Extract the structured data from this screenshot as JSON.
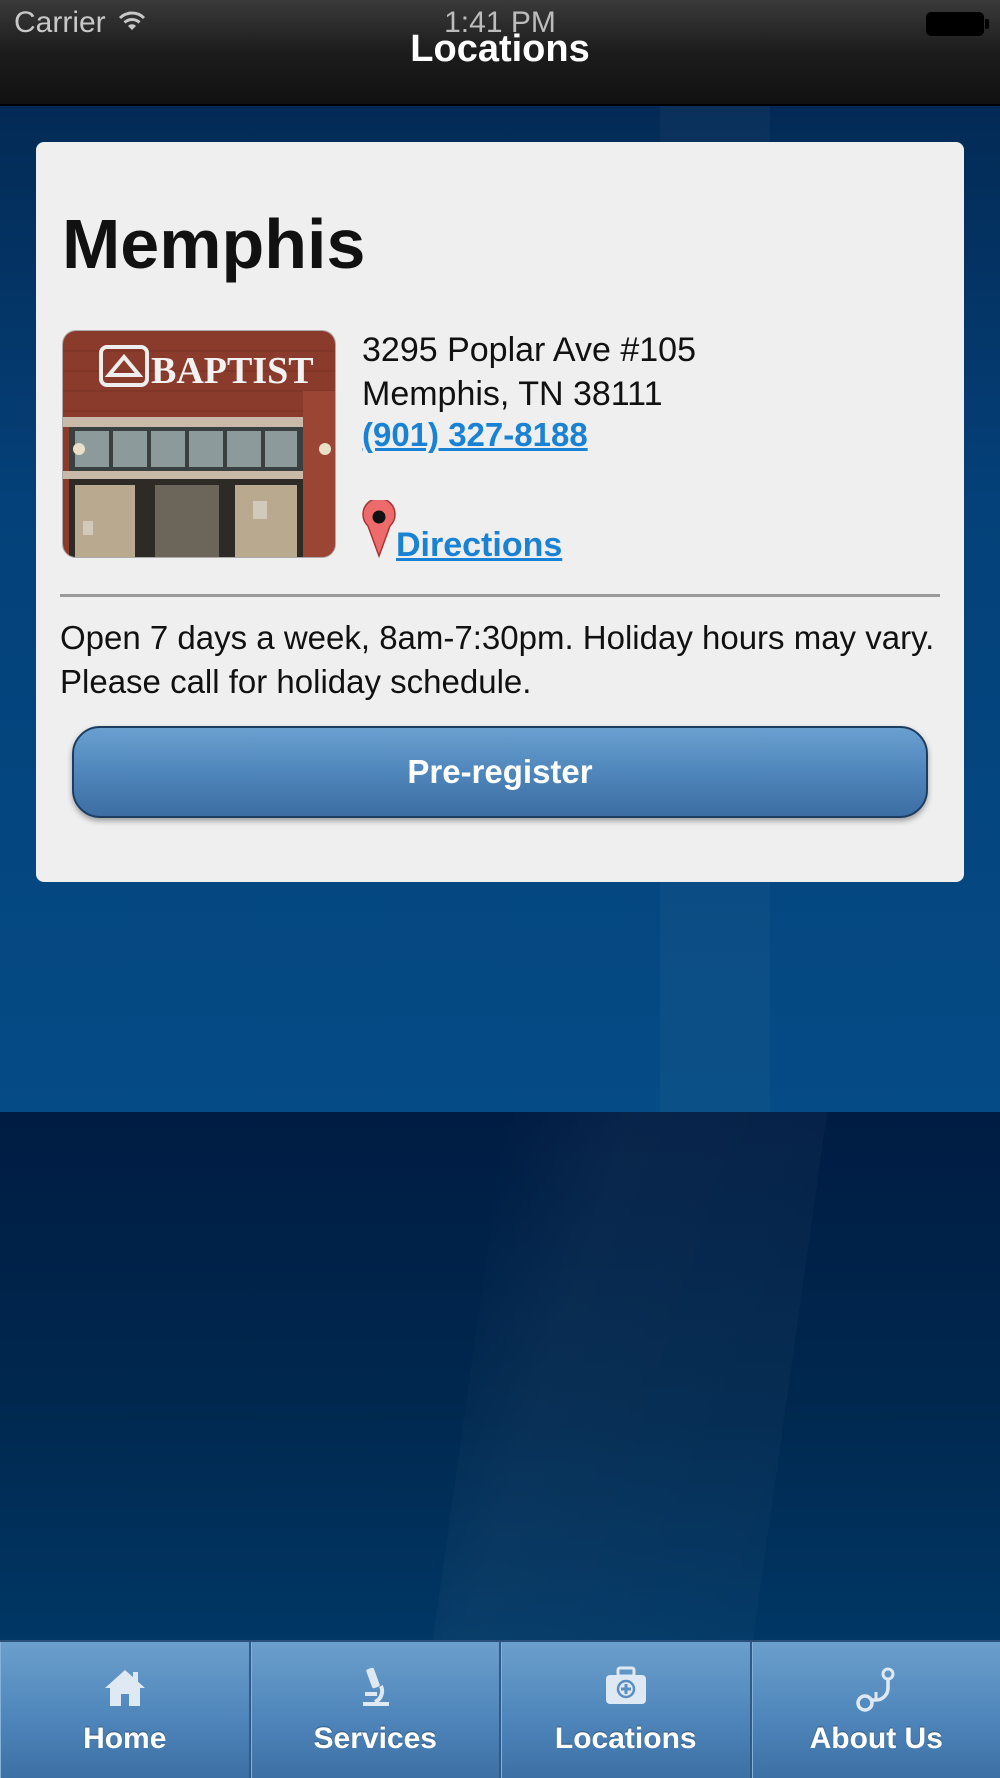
{
  "status_bar": {
    "carrier": "Carrier",
    "time": "1:41 PM"
  },
  "nav": {
    "title": "Locations"
  },
  "location": {
    "name": "Memphis",
    "photo_sign_text": "BAPTIST",
    "address_line1": "3295 Poplar Ave #105",
    "address_line2": "Memphis, TN 38111",
    "phone": "(901) 327-8188",
    "directions_label": "Directions",
    "hours": "Open 7 days a week, 8am-7:30pm. Holiday hours may vary. Please call for holiday schedule.",
    "preregister_label": "Pre-register"
  },
  "tabs": [
    {
      "label": "Home",
      "icon": "home-icon"
    },
    {
      "label": "Services",
      "icon": "microscope-icon"
    },
    {
      "label": "Locations",
      "icon": "medical-kit-icon"
    },
    {
      "label": "About Us",
      "icon": "stethoscope-icon"
    }
  ],
  "colors": {
    "link": "#1a82d4",
    "accent": "#4f86bb",
    "card": "#efefef"
  }
}
